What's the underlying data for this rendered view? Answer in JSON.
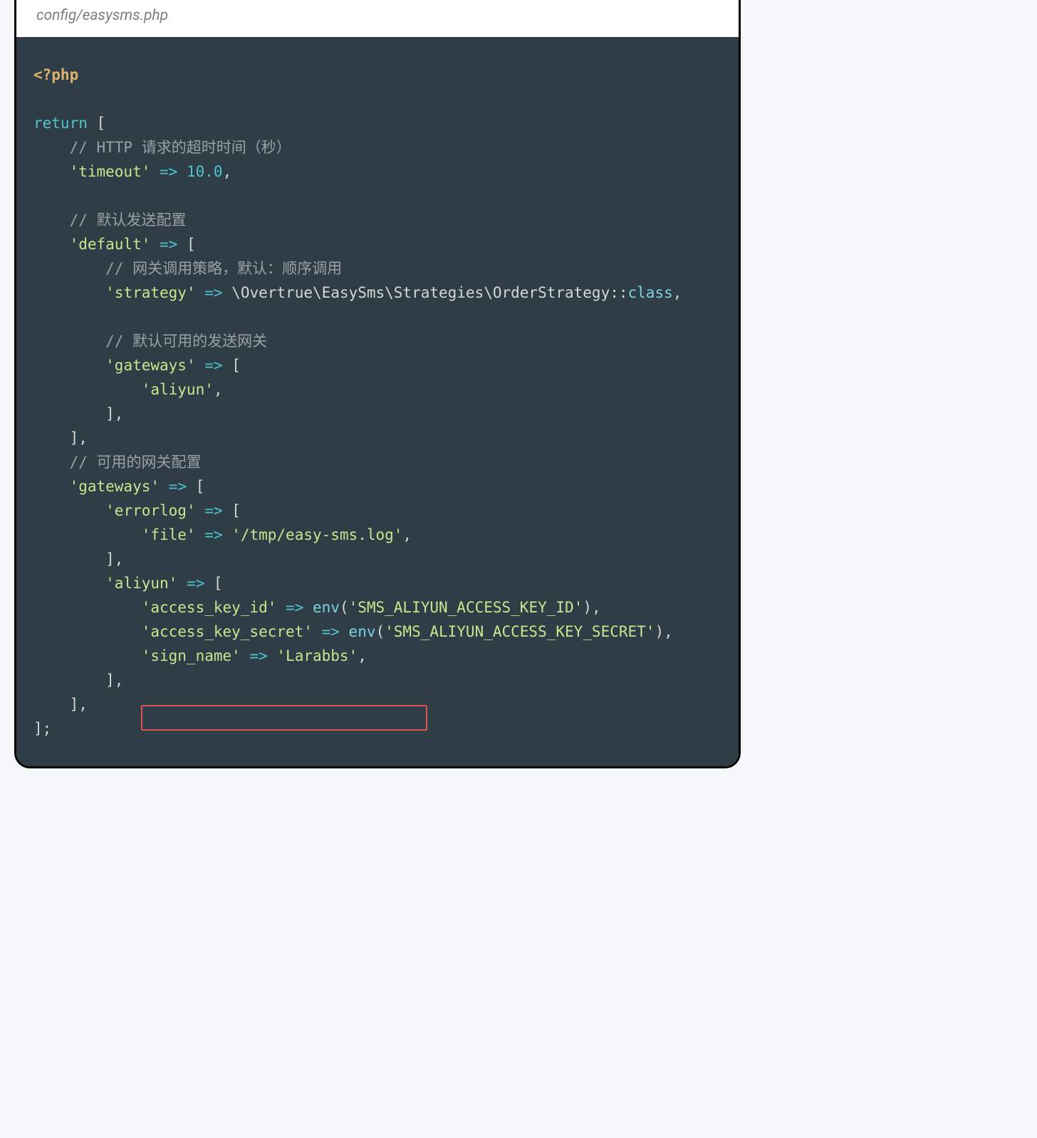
{
  "filepath": "config/easysms.php",
  "code": {
    "php_open": "<?php",
    "return_kw": "return",
    "br_open": "[",
    "br_close": "]",
    "br_close_sq": "],",
    "arrow": "=>",
    "semicolon_close": "];",
    "comma": ",",
    "paren_open": "(",
    "paren_close": ")",
    "dcolon": "::",
    "class_kw": "class",
    "comment_timeout": "// HTTP 请求的超时时间（秒）",
    "key_timeout": "'timeout'",
    "val_timeout": "10.0",
    "comment_default": "// 默认发送配置",
    "key_default": "'default'",
    "comment_strategy": "// 网关调用策略，默认：顺序调用",
    "key_strategy": "'strategy'",
    "val_strategy_class": "\\Overtrue\\EasySms\\Strategies\\OrderStrategy",
    "comment_gateways_avail": "// 默认可用的发送网关",
    "key_gateways": "'gateways'",
    "val_aliyun": "'aliyun'",
    "comment_gateway_cfg": "// 可用的网关配置",
    "key_gateways2": "'gateways'",
    "key_errorlog": "'errorlog'",
    "key_file": "'file'",
    "val_file": "'/tmp/easy-sms.log'",
    "key_aliyun": "'aliyun'",
    "key_aki": "'access_key_id'",
    "fn_env": "env",
    "val_aki": "'SMS_ALIYUN_ACCESS_KEY_ID'",
    "key_aks": "'access_key_secret'",
    "val_aks": "'SMS_ALIYUN_ACCESS_KEY_SECRET'",
    "key_sign": "'sign_name'",
    "val_sign": "'Larabbs'"
  }
}
